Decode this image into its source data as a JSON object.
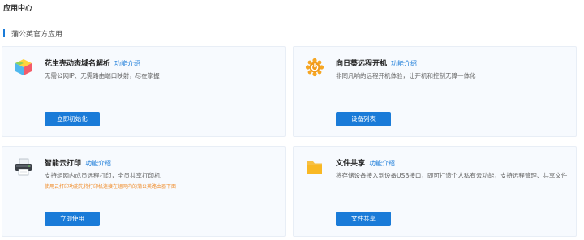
{
  "header": {
    "title": "应用中心"
  },
  "section": {
    "label": "蒲公英官方应用"
  },
  "colors": {
    "accent": "#1a7bd8",
    "warning": "#f08c2a",
    "card_bg": "#f7fafe"
  },
  "cards": [
    {
      "icon": "peanut-shell-cube-icon",
      "title": "花生壳动态域名解析",
      "link": "功能介绍",
      "desc": "无需公网IP、无需路由端口映射，尽在掌握",
      "button": "立即初始化"
    },
    {
      "icon": "sunflower-remote-icon",
      "title": "向日葵远程开机",
      "link": "功能介绍",
      "desc": "非同凡响的远程开机体验，让开机和控制无障一体化",
      "button": "设备列表"
    },
    {
      "icon": "printer-icon",
      "title": "智能云打印",
      "link": "功能介绍",
      "desc": "支持组网内成员远程打印，全员共享打印机",
      "warning": "使用云打印功能先将打印机连接在组网内的蒲公英路由器下面",
      "button": "立即使用"
    },
    {
      "icon": "folder-icon",
      "title": "文件共享",
      "link": "功能介绍",
      "desc": "将存储设备接入到设备USB接口，即可打造个人私有云功能，支持远程管理、共享文件",
      "button": "文件共享"
    }
  ]
}
